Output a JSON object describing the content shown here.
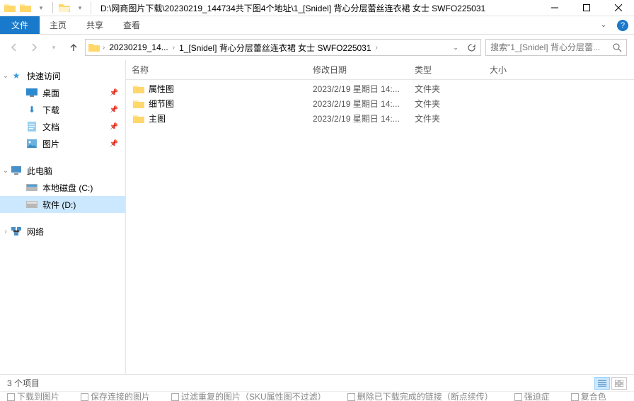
{
  "title": "D:\\网商图片下载\\20230219_144734共下图4个地址\\1_[Snidel] 背心分层蕾丝连衣裙 女士 SWFO225031",
  "ribbon": {
    "file": "文件",
    "home": "主页",
    "share": "共享",
    "view": "查看"
  },
  "breadcrumb": {
    "seg1": "20230219_14...",
    "seg2": "1_[Snidel] 背心分层蕾丝连衣裙 女士 SWFO225031"
  },
  "search_placeholder": "搜索\"1_[Snidel] 背心分层蕾...",
  "nav": {
    "quick": "快速访问",
    "desktop": "桌面",
    "downloads": "下载",
    "documents": "文档",
    "pictures": "图片",
    "thispc": "此电脑",
    "cdrive": "本地磁盘 (C:)",
    "ddrive": "软件 (D:)",
    "network": "网络"
  },
  "cols": {
    "name": "名称",
    "date": "修改日期",
    "type": "类型",
    "size": "大小"
  },
  "rows": [
    {
      "name": "属性图",
      "date": "2023/2/19 星期日 14:...",
      "type": "文件夹"
    },
    {
      "name": "细节图",
      "date": "2023/2/19 星期日 14:...",
      "type": "文件夹"
    },
    {
      "name": "主图",
      "date": "2023/2/19 星期日 14:...",
      "type": "文件夹"
    }
  ],
  "status": "3 个项目",
  "clipped": {
    "a": "下载到图片",
    "b": "保存连接的图片",
    "c": "过滤重复的图片（SKU属性图不过滤）",
    "d": "删除已下载完成的链接（断点续传）",
    "e": "强迫症",
    "f": "复合色"
  }
}
